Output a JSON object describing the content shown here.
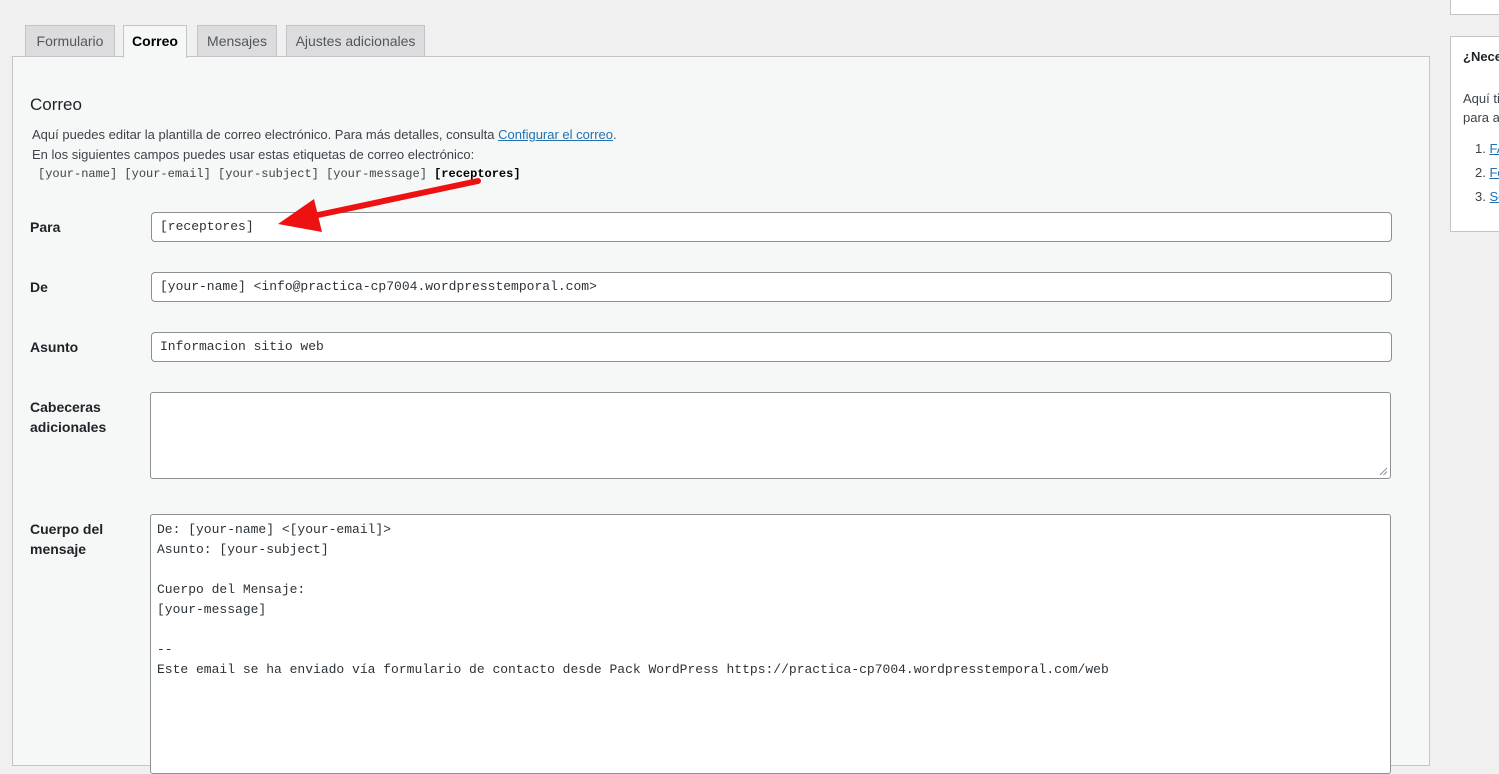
{
  "tabs": [
    {
      "label": "Formulario"
    },
    {
      "label": "Correo"
    },
    {
      "label": "Mensajes"
    },
    {
      "label": "Ajustes adicionales"
    }
  ],
  "mail": {
    "title": "Correo",
    "desc_line1": "Aquí puedes editar la plantilla de correo electrónico. Para más detalles, consulta ",
    "desc_link": "Configurar el correo",
    "desc_line1_end": ".",
    "desc_line2": "En los siguientes campos puedes usar estas etiquetas de correo electrónico:",
    "tags": [
      "[your-name]",
      "[your-email]",
      "[your-subject]",
      "[your-message]"
    ],
    "tag_highlight": "[receptores]"
  },
  "fields": {
    "to_label": "Para",
    "to_value": "[receptores]",
    "from_label": "De",
    "from_value": "[your-name] <info@practica-cp7004.wordpresstemporal.com>",
    "subject_label": "Asunto",
    "subject_value": "Informacion sitio web",
    "headers_label_1": "Cabeceras",
    "headers_label_2": "adicionales",
    "headers_value": "",
    "body_label_1": "Cuerpo del",
    "body_label_2": "mensaje",
    "body_value": "De: [your-name] <[your-email]>\nAsunto: [your-subject]\n\nCuerpo del Mensaje:\n[your-message]\n\n--\nEste email se ha enviado vía formulario de contacto desde Pack WordPress https://practica-cp7004.wordpresstemporal.com/web"
  },
  "sidebar": {
    "title": "¿Nece",
    "text_1": "Aquí ti",
    "text_2": "para a",
    "items": [
      {
        "num": "1. ",
        "link": "FA"
      },
      {
        "num": "2. ",
        "link": "Fo"
      },
      {
        "num": "3. ",
        "link": "Se"
      }
    ]
  },
  "colors": {
    "annotation_arrow": "#ee1111",
    "link": "#2271b1"
  }
}
